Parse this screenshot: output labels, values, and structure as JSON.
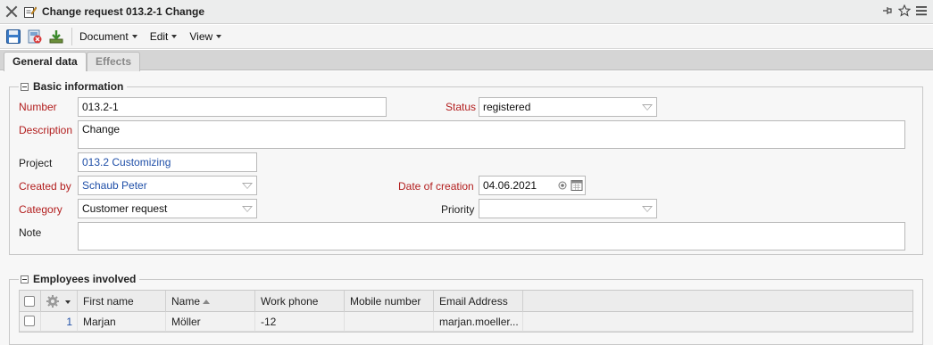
{
  "window": {
    "title": "Change request 013.2-1 Change"
  },
  "toolbar": {
    "menus": [
      "Document",
      "Edit",
      "View"
    ]
  },
  "tabs": [
    {
      "label": "General data",
      "active": true
    },
    {
      "label": "Effects",
      "active": false
    }
  ],
  "basic_info": {
    "legend": "Basic information",
    "number_label": "Number",
    "number_value": "013.2-1",
    "status_label": "Status",
    "status_value": "registered",
    "description_label": "Description",
    "description_value": "Change",
    "project_label": "Project",
    "project_value": "013.2 Customizing",
    "created_by_label": "Created by",
    "created_by_value": "Schaub Peter",
    "date_label": "Date of creation",
    "date_value": "04.06.2021",
    "category_label": "Category",
    "category_value": "Customer request",
    "priority_label": "Priority",
    "priority_value": "",
    "note_label": "Note",
    "note_value": ""
  },
  "employees": {
    "legend": "Employees involved",
    "columns": [
      "First name",
      "Name",
      "Work phone",
      "Mobile number",
      "Email Address"
    ],
    "rows": [
      {
        "index": "1",
        "first_name": "Marjan",
        "name": "Möller",
        "work_phone": "-12",
        "mobile": "",
        "email": "marjan.moeller..."
      }
    ]
  },
  "colors": {
    "required_label": "#b21d1d",
    "link": "#1f4fa8"
  }
}
